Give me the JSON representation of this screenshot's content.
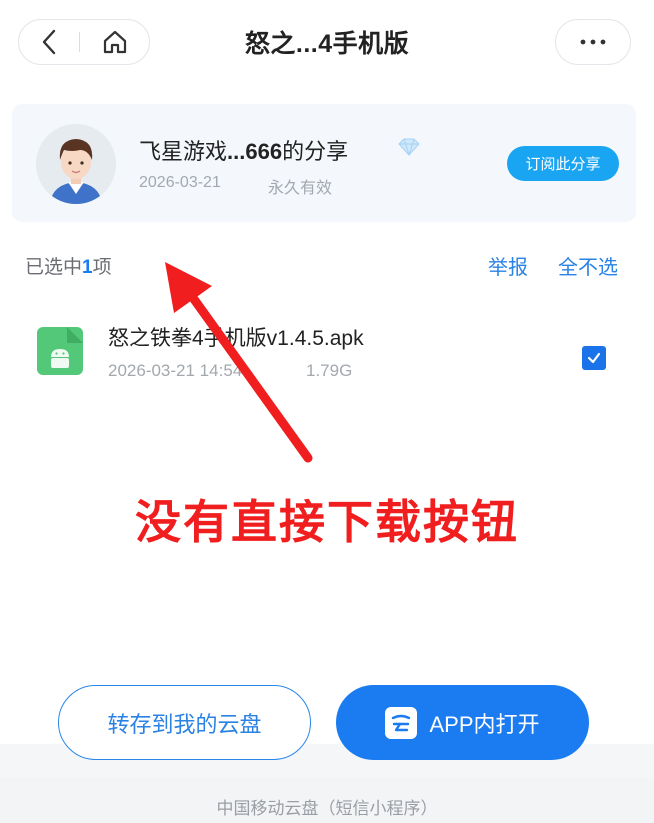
{
  "header": {
    "title": "怒之...4手机版"
  },
  "sharer": {
    "name_prefix": "飞星游戏",
    "name_bold": "...666",
    "name_suffix": "的分享",
    "date": "2026-03-21",
    "validity": "永久有效",
    "subscribe_label": "订阅此分享"
  },
  "selection": {
    "prefix": "已选中",
    "count": "1",
    "suffix": "项",
    "report_label": "举报",
    "deselect_all_label": "全不选"
  },
  "files": [
    {
      "name": "怒之铁拳4手机版v1.4.5.apk",
      "date": "2026-03-21 14:54",
      "size": "1.79G",
      "checked": true
    }
  ],
  "annotation": {
    "text": "没有直接下载按钮",
    "color": "#f01e1e"
  },
  "actions": {
    "save_label": "转存到我的云盘",
    "open_app_label": "APP内打开"
  },
  "footer": {
    "text": "中国移动云盘（短信小程序）"
  },
  "colors": {
    "accent": "#1a7cf0",
    "link": "#2a82e4",
    "subscribe": "#1aa5f3",
    "file_icon": "#52c878"
  }
}
